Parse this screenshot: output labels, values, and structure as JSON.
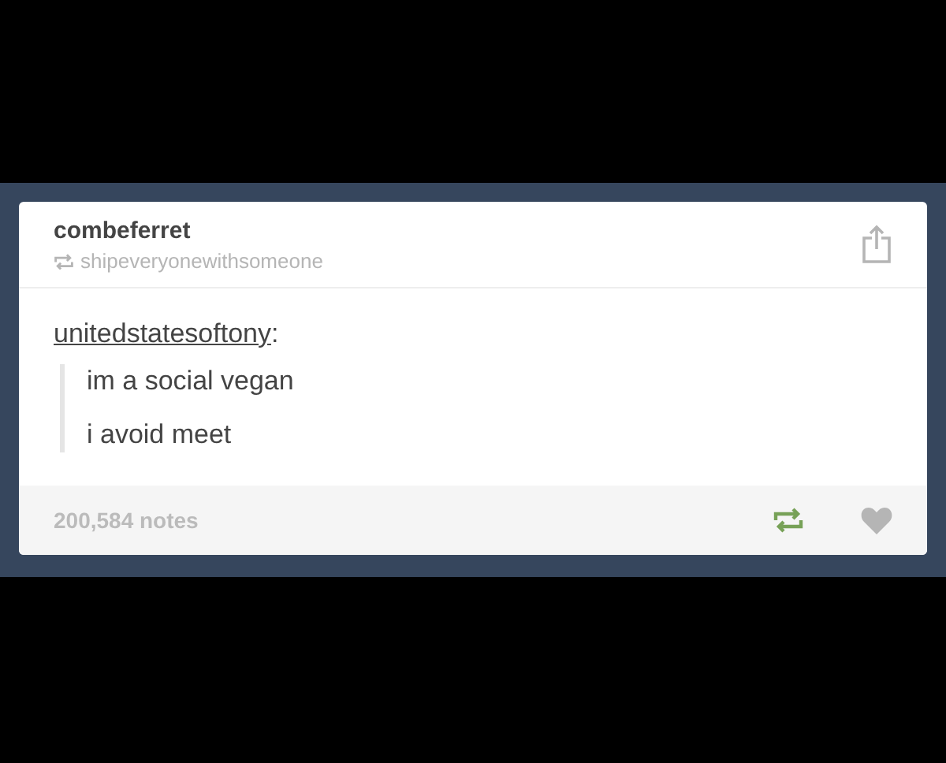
{
  "post": {
    "author": "combeferret",
    "reblogged_from": "shipeveryonewithsomeone",
    "source": "unitedstatesoftony",
    "source_suffix": ":",
    "quote_lines": [
      "im a social vegan",
      "i avoid meet"
    ],
    "notes": "200,584 notes",
    "reblogged": true,
    "liked": false
  }
}
